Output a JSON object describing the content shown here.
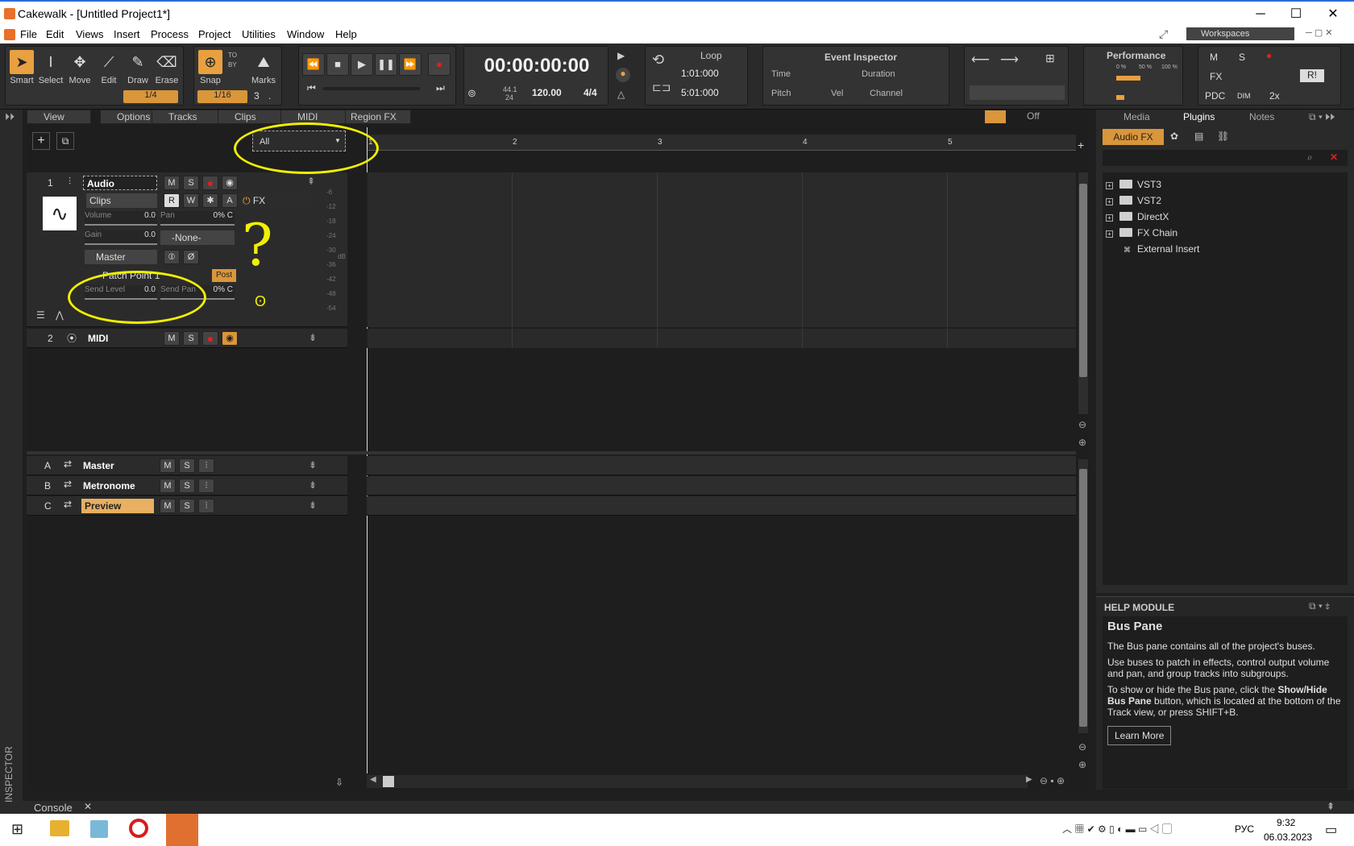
{
  "window": {
    "title": "Cakewalk - [Untitled Project1*]"
  },
  "menu": [
    "File",
    "Edit",
    "Views",
    "Insert",
    "Process",
    "Project",
    "Utilities",
    "Window",
    "Help"
  ],
  "workspaces": "Workspaces",
  "tools": [
    {
      "label": "Smart",
      "icon": "arrow-icon"
    },
    {
      "label": "Select",
      "icon": "ibeam-icon"
    },
    {
      "label": "Move",
      "icon": "move-icon"
    },
    {
      "label": "Edit",
      "icon": "edit-icon"
    },
    {
      "label": "Draw",
      "icon": "pencil-icon"
    },
    {
      "label": "Erase",
      "icon": "eraser-icon"
    }
  ],
  "snap": {
    "label": "Snap",
    "tool_res": "1/4",
    "snap_res": "1/16",
    "to": "TO",
    "by": "BY",
    "marks_label": "Marks",
    "marks_value": "3",
    "dot": "."
  },
  "transport": {
    "time": "00:00:00:00",
    "sample_rate": "44.1",
    "bits": "24",
    "tempo": "120.00",
    "meter": "4/4"
  },
  "loop": {
    "title": "Loop",
    "start": "1:01:000",
    "end": "5:01:000"
  },
  "event_inspector": {
    "title": "Event Inspector",
    "time": "Time",
    "duration": "Duration",
    "pitch": "Pitch",
    "vel": "Vel",
    "channel": "Channel"
  },
  "performance": {
    "title": "Performance",
    "pct1": "0 %",
    "pct2": "50 %",
    "pct3": "100 %"
  },
  "mix": {
    "m": "M",
    "s": "S",
    "fx": "FX",
    "pdc": "PDC",
    "dim": "DIM",
    "x2": "2x",
    "ri": "R!"
  },
  "trackmenus": [
    "View",
    "Options",
    "Tracks",
    "Clips",
    "MIDI",
    "Region FX"
  ],
  "filter": {
    "value": "All"
  },
  "off_label": "Off",
  "ruler": [
    "1",
    "2",
    "3",
    "4",
    "5"
  ],
  "tracks": [
    {
      "num": "1",
      "name": "Audio",
      "mode": "Clips",
      "volume_label": "Volume",
      "volume_value": "0.0",
      "pan_label": "Pan",
      "pan_value": "0% C",
      "gain_label": "Gain",
      "gain_value": "0.0",
      "input": "-None-",
      "output": "Master",
      "fx": "FX",
      "send": "Patch Point 1",
      "post": "Post",
      "send_level_label": "Send Level",
      "send_level_value": "0.0",
      "send_pan_label": "Send Pan",
      "send_pan_value": "0% C",
      "r": "R",
      "w": "W",
      "a": "A"
    },
    {
      "num": "2",
      "name": "MIDI"
    }
  ],
  "meter_scale": [
    "-6",
    "-12",
    "-18",
    "-24",
    "-30",
    "-36",
    "-42",
    "-48",
    "-54"
  ],
  "meter_db": "dB",
  "buses": [
    {
      "letter": "A",
      "name": "Master"
    },
    {
      "letter": "B",
      "name": "Metronome"
    },
    {
      "letter": "C",
      "name": "Preview"
    }
  ],
  "annotations": {
    "question": "?",
    "mark": "ʘ"
  },
  "browser": {
    "tabs": [
      "Media",
      "Plugins",
      "Notes"
    ],
    "audio_fx": "Audio FX",
    "tree": [
      "VST3",
      "VST2",
      "DirectX",
      "FX Chain",
      "External Insert"
    ]
  },
  "help": {
    "header": "HELP MODULE",
    "title": "Bus Pane",
    "p1": "The Bus pane contains all of the project's buses.",
    "p2": "Use buses to patch in effects, control output volume and pan, and group tracks into subgroups.",
    "p3a": "To show or hide the Bus pane, click the ",
    "p3b": "Show/Hide Bus Pane",
    "p3c": " button, which is located at the bottom of the Track view, or press SHIFT+B.",
    "learn": "Learn More"
  },
  "console": "Console",
  "inspector": "INSPECTOR",
  "taskbar": {
    "lang": "РУС",
    "time": "9:32",
    "date": "06.03.2023"
  },
  "colors": {
    "accent": "#d9963a",
    "annotation": "#f0f000"
  }
}
